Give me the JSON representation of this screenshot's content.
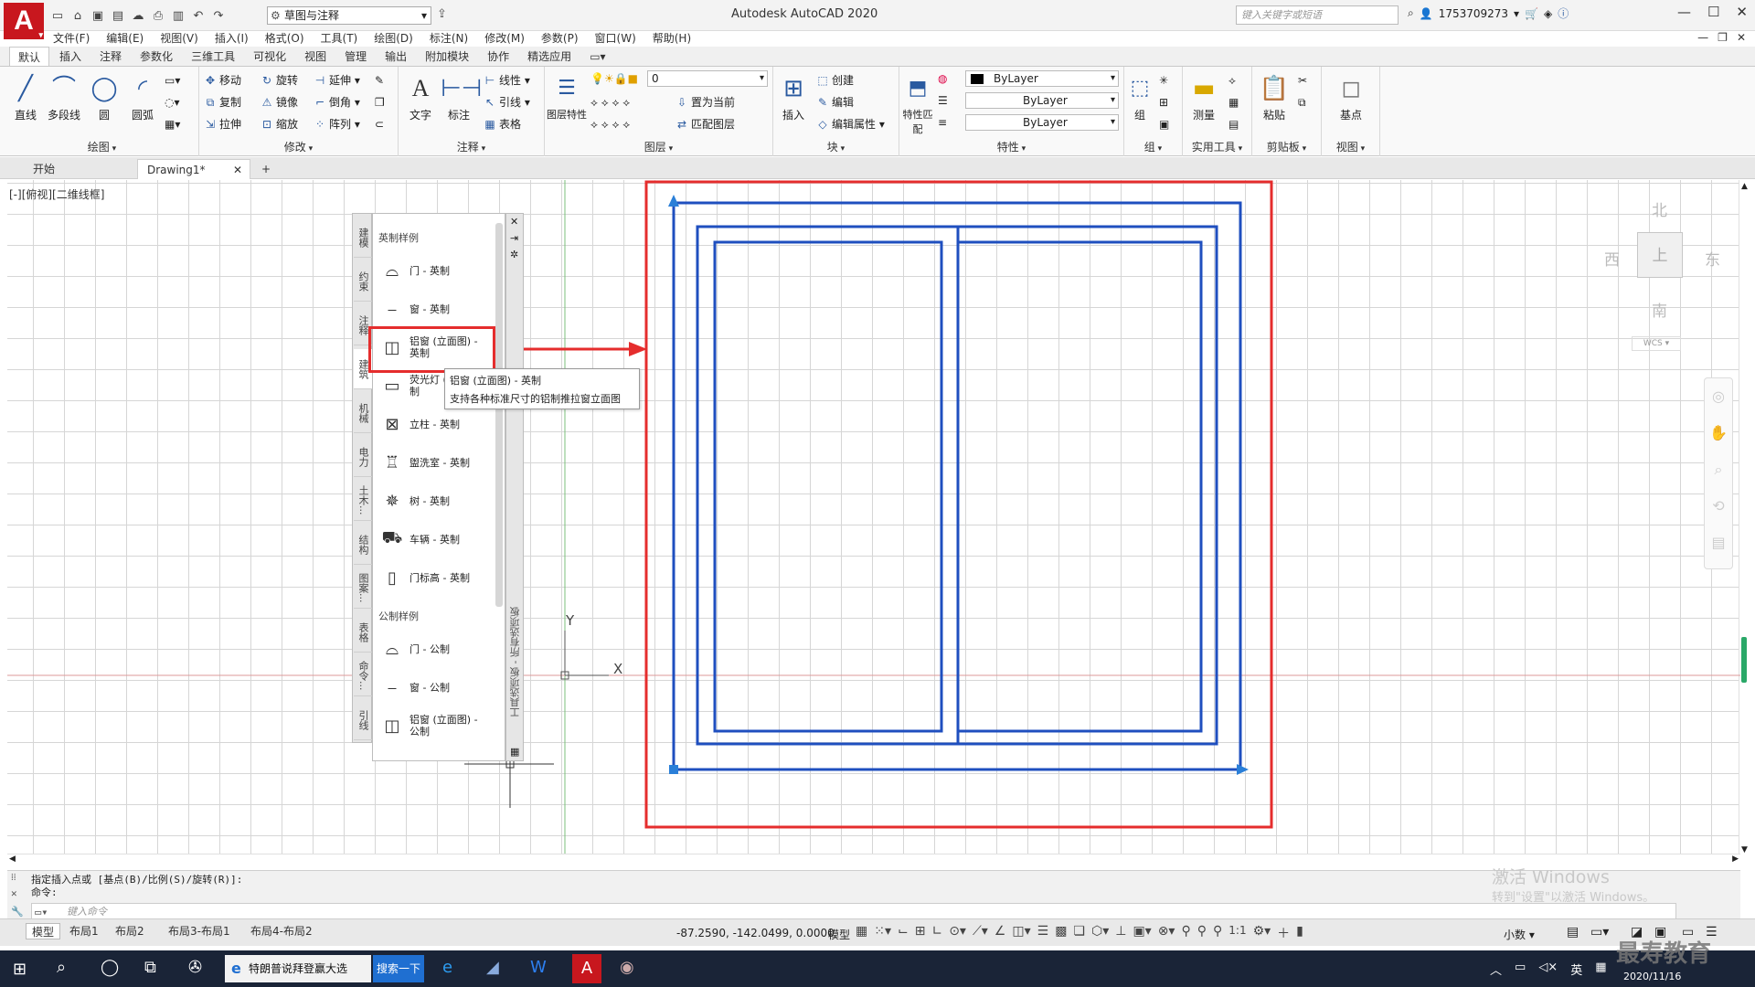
{
  "app": {
    "logo": "A",
    "title": "Autodesk AutoCAD 2020",
    "workspace": "草图与注释",
    "search_placeholder": "键入关键字或短语",
    "user": "1753709273"
  },
  "menu": [
    "文件(F)",
    "编辑(E)",
    "视图(V)",
    "插入(I)",
    "格式(O)",
    "工具(T)",
    "绘图(D)",
    "标注(N)",
    "修改(M)",
    "参数(P)",
    "窗口(W)",
    "帮助(H)"
  ],
  "ribbon_tabs": [
    "默认",
    "插入",
    "注释",
    "参数化",
    "三维工具",
    "可视化",
    "视图",
    "管理",
    "输出",
    "附加模块",
    "协作",
    "精选应用"
  ],
  "ribbon": {
    "draw": {
      "title": "绘图",
      "line": "直线",
      "polyline": "多段线",
      "circle": "圆",
      "arc": "圆弧"
    },
    "modify": {
      "title": "修改",
      "move": "移动",
      "rotate": "旋转",
      "trim": "延伸",
      "copy": "复制",
      "mirror": "镜像",
      "fillet": "倒角",
      "stretch": "拉伸",
      "scale": "缩放",
      "array": "阵列"
    },
    "annotation": {
      "title": "注释",
      "text": "文字",
      "dimension": "标注",
      "linear": "线性",
      "leader": "引线",
      "table": "表格"
    },
    "layers": {
      "title": "图层",
      "props": "图层特性",
      "layer_value": "0",
      "set_current": "置为当前",
      "match_layer": "匹配图层"
    },
    "block": {
      "title": "块",
      "insert": "插入",
      "create": "创建",
      "edit": "编辑",
      "edit_attr": "编辑属性"
    },
    "properties": {
      "title": "特性",
      "match": "特性匹配",
      "color": "ByLayer",
      "linetype": "ByLayer",
      "lineweight": "ByLayer"
    },
    "groups": {
      "title": "组",
      "group": "组"
    },
    "utilities": {
      "title": "实用工具",
      "measure": "测量"
    },
    "clipboard": {
      "title": "剪贴板",
      "paste": "粘贴"
    },
    "view": {
      "title": "视图",
      "base": "基点"
    }
  },
  "file_tabs": {
    "start": "开始",
    "drawing": "Drawing1*",
    "add": "+"
  },
  "viewport_label": "[-][俯视][二维线框]",
  "palette": {
    "tabs": [
      "建模",
      "约束",
      "注释",
      "建筑",
      "机械",
      "电力",
      "土木...",
      "结构",
      "图案...",
      "表格",
      "命令...",
      "引线"
    ],
    "active_tab": "建筑",
    "section_imperial": "英制样例",
    "section_metric": "公制样例",
    "imperial_items": [
      "门 - 英制",
      "窗 - 英制",
      "铝窗 (立面图) - 英制",
      "荧光灯 (式) - 英制",
      "立柱 - 英制",
      "盥洗室 - 英制",
      "树 - 英制",
      "车辆 - 英制",
      "门标高 - 英制"
    ],
    "metric_items": [
      "门 - 公制",
      "窗 - 公制",
      "铝窗 (立面图) - 公制"
    ],
    "side_label": "工具选项板 - 所有选项板"
  },
  "tooltip": {
    "title": "铝窗 (立面图) - 英制",
    "desc": "支持各种标准尺寸的铝制推拉窗立面图"
  },
  "ucs": {
    "x": "X",
    "y": "Y"
  },
  "viewcube": {
    "north": "北",
    "south": "南",
    "east": "东",
    "west": "西",
    "top": "上",
    "wcs": "WCS"
  },
  "command": {
    "history1": "指定插入点或 [基点(B)/比例(S)/旋转(R)]:",
    "history2": "命令:",
    "placeholder": "键入命令"
  },
  "activation": {
    "line1": "激活 Windows",
    "line2": "转到\"设置\"以激活 Windows。"
  },
  "layout_tabs": [
    "模型",
    "布局1",
    "布局2",
    "布局3-布局1",
    "布局4-布局2"
  ],
  "status": {
    "coords": "-87.2590, -142.0499, 0.0000",
    "model": "模型",
    "scale": "1:1",
    "units": "小数"
  },
  "taskbar": {
    "browser": "特朗普说拜登赢大选",
    "search": "搜索一下",
    "ime": "英",
    "date": "2020/11/16"
  },
  "brand_watermark": "最寿教育",
  "colors": {
    "red_annotation": "#e52d2d",
    "window_blue": "#1f4fbf",
    "grid": "#d6d6d6"
  }
}
